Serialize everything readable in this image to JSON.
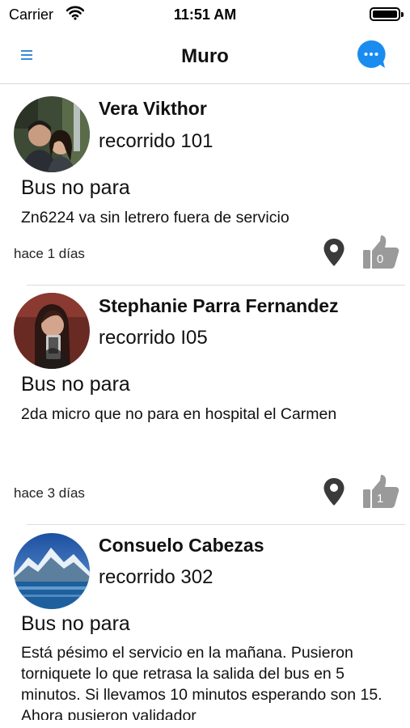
{
  "status_bar": {
    "carrier": "Carrier",
    "time": "11:51 AM"
  },
  "header": {
    "title": "Muro"
  },
  "posts": [
    {
      "author": "Vera Vikthor",
      "route": "recorrido 101",
      "title": "Bus no para",
      "body": "Zn6224 va sin  letrero fuera de servicio",
      "time_ago": "hace 1 días",
      "likes": "0"
    },
    {
      "author": "Stephanie Parra Fernandez",
      "route": "recorrido I05",
      "title": "Bus no para",
      "body": "2da micro que no para en hospital el Carmen",
      "time_ago": "hace 3 días",
      "likes": "1"
    },
    {
      "author": "Consuelo Cabezas",
      "route": "recorrido 302",
      "title": "Bus no para",
      "body": "Está pésimo el servicio en la mañana. Pusieron torniquete lo que retrasa la salida del bus en 5 minutos. Si llevamos 10 minutos esperando son 15. Ahora pusieron validador"
    }
  ],
  "colors": {
    "accent": "#3b8bd6",
    "chat_button": "#1a8cf0",
    "like_icon": "#9a9a9a",
    "pin_icon": "#3a3a3a"
  }
}
